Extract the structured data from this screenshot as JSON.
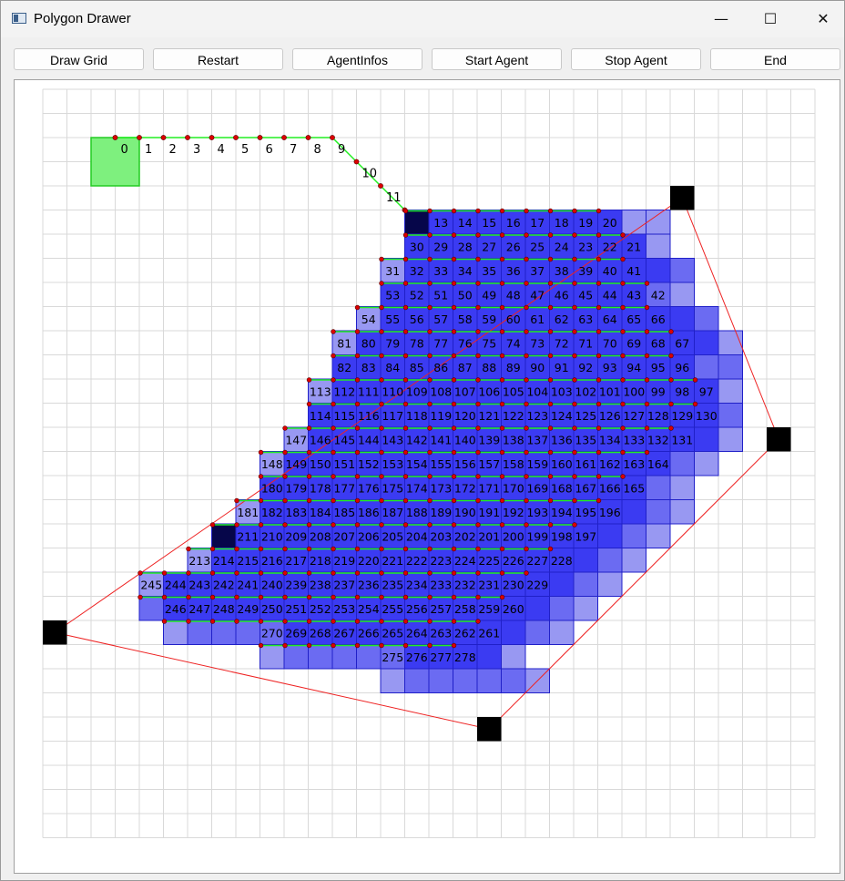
{
  "window": {
    "title": "Polygon Drawer",
    "minimize_icon": "minimize-icon",
    "maximize_icon": "maximize-icon",
    "close_icon": "close-icon"
  },
  "toolbar": {
    "draw_grid": "Draw Grid",
    "restart": "Restart",
    "agent_infos": "AgentInfos",
    "start_agent": "Start Agent",
    "stop_agent": "Stop Agent",
    "end": "End"
  },
  "grid": {
    "cols": 32,
    "rows": 31
  },
  "colors": {
    "path_green": "#22ee22",
    "waypoint_red": "#dd0000",
    "boundary_red": "#ee2222",
    "cell_deep": "#3b3bf2",
    "cell_mid": "#6b6bf2",
    "cell_light": "#9898f2",
    "cell_border": "#2020c8",
    "agent_dark": "#06064a",
    "start_green": "#7ef07e"
  },
  "polygon_vertices": [
    [
      26.5,
      4.5
    ],
    [
      30.5,
      14.5
    ],
    [
      18.5,
      26.5
    ],
    [
      0.5,
      22.5
    ]
  ],
  "start_cell": [
    2,
    2
  ],
  "agent_cells": [
    [
      15,
      5
    ],
    [
      7,
      18
    ]
  ],
  "path_labels": [
    {
      "n": "0",
      "c": 3,
      "r": 2
    },
    {
      "n": "1",
      "c": 4,
      "r": 2
    },
    {
      "n": "2",
      "c": 5,
      "r": 2
    },
    {
      "n": "3",
      "c": 6,
      "r": 2
    },
    {
      "n": "4",
      "c": 7,
      "r": 2
    },
    {
      "n": "5",
      "c": 8,
      "r": 2
    },
    {
      "n": "6",
      "c": 9,
      "r": 2
    },
    {
      "n": "7",
      "c": 10,
      "r": 2
    },
    {
      "n": "8",
      "c": 11,
      "r": 2
    },
    {
      "n": "9",
      "c": 12,
      "r": 2
    },
    {
      "n": "10",
      "c": 13,
      "r": 3
    },
    {
      "n": "11",
      "c": 14,
      "r": 4
    }
  ],
  "cell_rows": [
    {
      "r": 5,
      "c0": 15,
      "nums": [
        "",
        "13",
        "14",
        "15",
        "16",
        "17",
        "18",
        "19",
        "20"
      ],
      "shades": "dmmmmmmmmLL"
    },
    {
      "r": 6,
      "c0": 15,
      "nums": [
        "30",
        "29",
        "28",
        "27",
        "26",
        "25",
        "24",
        "23",
        "22",
        "21"
      ],
      "shades": "mmmmmmmmmmL"
    },
    {
      "r": 7,
      "c0": 14,
      "nums": [
        "31",
        "32",
        "33",
        "34",
        "35",
        "36",
        "37",
        "38",
        "39",
        "40",
        "41"
      ],
      "shades": "LmmmmmmmmmmmM"
    },
    {
      "r": 8,
      "c0": 14,
      "nums": [
        "53",
        "52",
        "51",
        "50",
        "49",
        "48",
        "47",
        "46",
        "45",
        "44",
        "43",
        "42"
      ],
      "shades": "mmmmmmmmmmmlL"
    },
    {
      "r": 9,
      "c0": 13,
      "nums": [
        "54",
        "55",
        "56",
        "57",
        "58",
        "59",
        "60",
        "61",
        "62",
        "63",
        "64",
        "65",
        "66"
      ],
      "shades": "LmmmmmmmmmmmmmM"
    },
    {
      "r": 10,
      "c0": 12,
      "nums": [
        "81",
        "80",
        "79",
        "78",
        "77",
        "76",
        "75",
        "74",
        "73",
        "72",
        "71",
        "70",
        "69",
        "68",
        "67"
      ],
      "shades": "LmmmmmmmmmmmmmmmL"
    },
    {
      "r": 11,
      "c0": 12,
      "nums": [
        "82",
        "83",
        "84",
        "85",
        "86",
        "87",
        "88",
        "89",
        "90",
        "91",
        "92",
        "93",
        "94",
        "95",
        "96"
      ],
      "shades": "mmmmmmmmmmmmmmmMM"
    },
    {
      "r": 12,
      "c0": 11,
      "nums": [
        "113",
        "112",
        "111",
        "110",
        "109",
        "108",
        "107",
        "106",
        "105",
        "104",
        "103",
        "102",
        "101",
        "100",
        "99",
        "98",
        "97"
      ],
      "shades": "LmmmmmmmmmmmmmmmmL"
    },
    {
      "r": 13,
      "c0": 11,
      "nums": [
        "114",
        "115",
        "116",
        "117",
        "118",
        "119",
        "120",
        "121",
        "122",
        "123",
        "124",
        "125",
        "126",
        "127",
        "128",
        "129",
        "130"
      ],
      "shades": "mmmmmmmmmmmmmmmmmM"
    },
    {
      "r": 14,
      "c0": 10,
      "nums": [
        "147",
        "146",
        "145",
        "144",
        "143",
        "142",
        "141",
        "140",
        "139",
        "138",
        "137",
        "136",
        "135",
        "134",
        "133",
        "132",
        "131"
      ],
      "shades": "LmmmmmmmmmmmmmmmmmL"
    },
    {
      "r": 15,
      "c0": 9,
      "nums": [
        "148",
        "149",
        "150",
        "151",
        "152",
        "153",
        "154",
        "155",
        "156",
        "157",
        "158",
        "159",
        "160",
        "161",
        "162",
        "163",
        "164"
      ],
      "shades": "LmmmmmmmmmmmmmmmmML"
    },
    {
      "r": 16,
      "c0": 9,
      "nums": [
        "180",
        "179",
        "178",
        "177",
        "176",
        "175",
        "174",
        "173",
        "172",
        "171",
        "170",
        "169",
        "168",
        "167",
        "166",
        "165"
      ],
      "shades": "mmmmmmmmmmmmmmmmML"
    },
    {
      "r": 17,
      "c0": 8,
      "nums": [
        "181",
        "182",
        "183",
        "184",
        "185",
        "186",
        "187",
        "188",
        "189",
        "190",
        "191",
        "192",
        "193",
        "194",
        "195",
        "196"
      ],
      "shades": "LmmmmmmmmmmmmmmmmML"
    },
    {
      "r": 18,
      "c0": 7,
      "nums": [
        "",
        "211",
        "210",
        "209",
        "208",
        "207",
        "206",
        "205",
        "204",
        "203",
        "202",
        "201",
        "200",
        "199",
        "198",
        "197"
      ],
      "shades": "dmmmmmmmmmmmmmmmmML"
    },
    {
      "r": 19,
      "c0": 6,
      "nums": [
        "213",
        "214",
        "215",
        "216",
        "217",
        "218",
        "219",
        "220",
        "221",
        "222",
        "223",
        "224",
        "225",
        "226",
        "227",
        "228"
      ],
      "shades": "LmmmmmmmmmmmmmmmmML"
    },
    {
      "r": 20,
      "c0": 4,
      "nums": [
        "245",
        "244",
        "243",
        "242",
        "241",
        "240",
        "239",
        "238",
        "237",
        "236",
        "235",
        "234",
        "233",
        "232",
        "231",
        "230",
        "229"
      ],
      "shades": "LmmmmmmmmmmmmmmmmmML"
    },
    {
      "r": 21,
      "c0": 4,
      "nums": [
        "",
        "246",
        "247",
        "248",
        "249",
        "250",
        "251",
        "252",
        "253",
        "254",
        "255",
        "256",
        "257",
        "258",
        "259",
        "260"
      ],
      "shades": "MmmmmmmmmmmmmmmmmML"
    },
    {
      "r": 22,
      "c0": 5,
      "nums": [
        "",
        "",
        "",
        "",
        "270",
        "269",
        "268",
        "267",
        "266",
        "265",
        "264",
        "263",
        "262",
        "261"
      ],
      "shades": "LMMMMmmmmmmmmmmML"
    },
    {
      "r": 23,
      "c0": 9,
      "nums": [
        "",
        "",
        "",
        "",
        "",
        "275",
        "276",
        "277",
        "278"
      ],
      "shades": "LMMMMMmmmmL"
    },
    {
      "r": 24,
      "c0": 14,
      "nums": [],
      "shades": "LMMMMML"
    }
  ]
}
